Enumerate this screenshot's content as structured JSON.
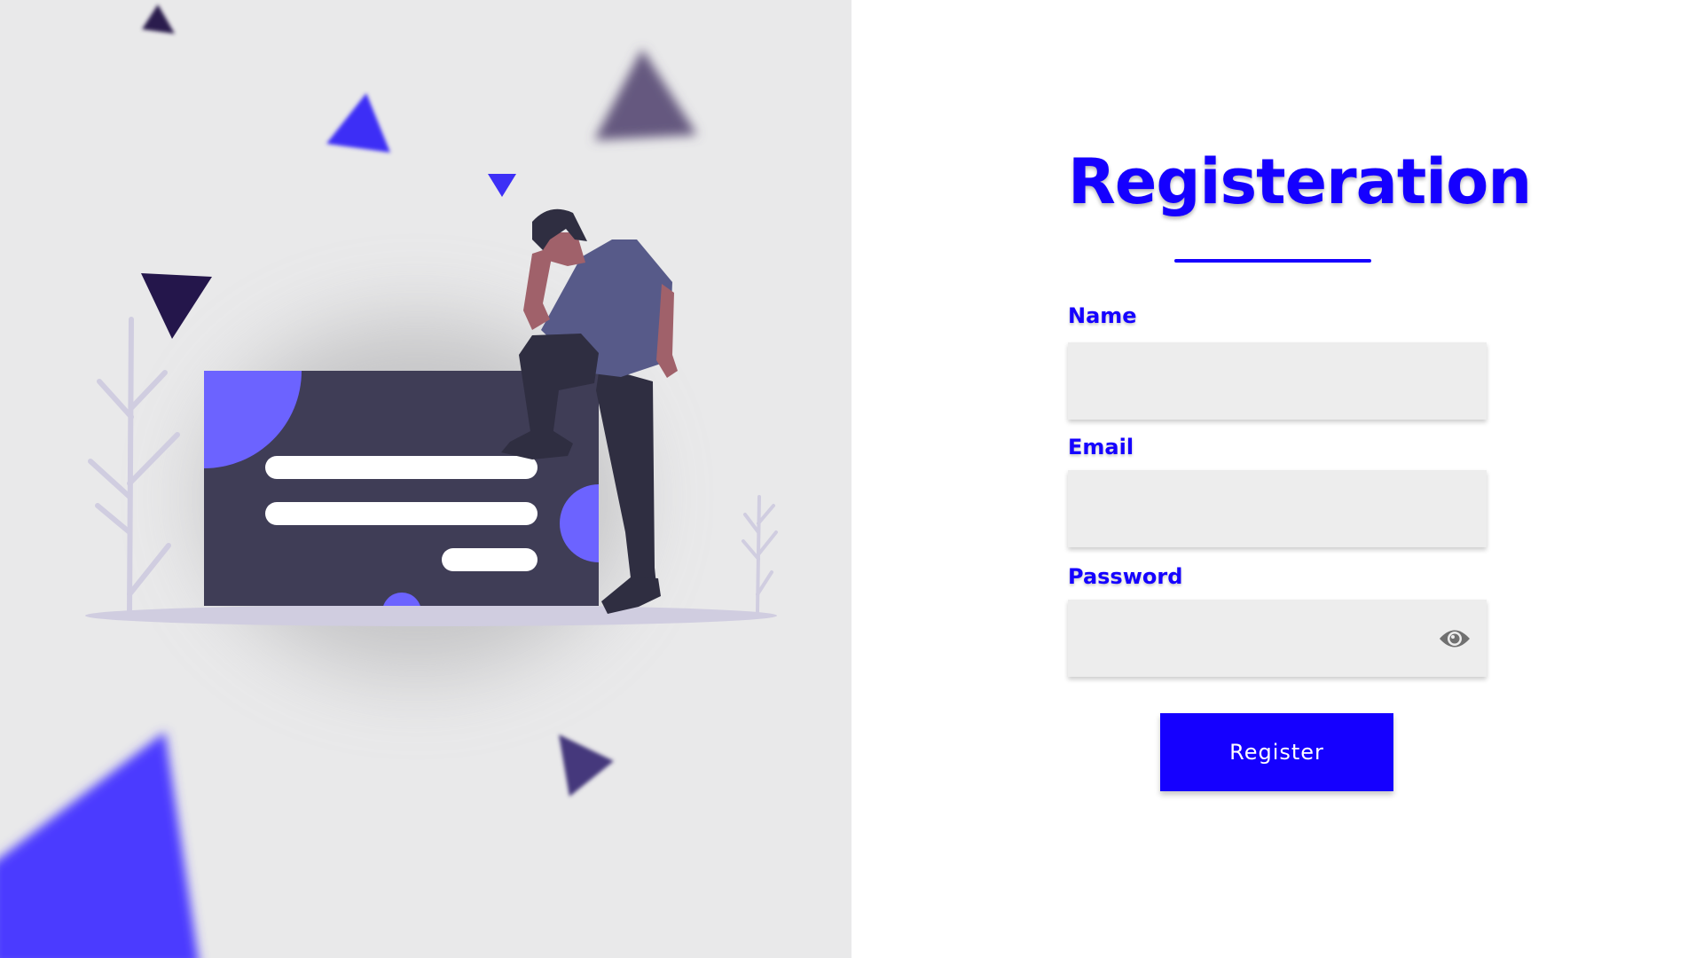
{
  "form": {
    "title": "Registeration",
    "name_label": "Name",
    "name_value": "",
    "email_label": "Email",
    "email_value": "",
    "password_label": "Password",
    "password_value": "",
    "submit_label": "Register"
  },
  "icons": {
    "password_toggle": "eye-icon"
  },
  "colors": {
    "accent": "#1500ff",
    "left_background": "#e9e9ea",
    "input_background": "#ededed",
    "illustration_card": "#3f3d56",
    "illustration_purple": "#6c63ff"
  }
}
